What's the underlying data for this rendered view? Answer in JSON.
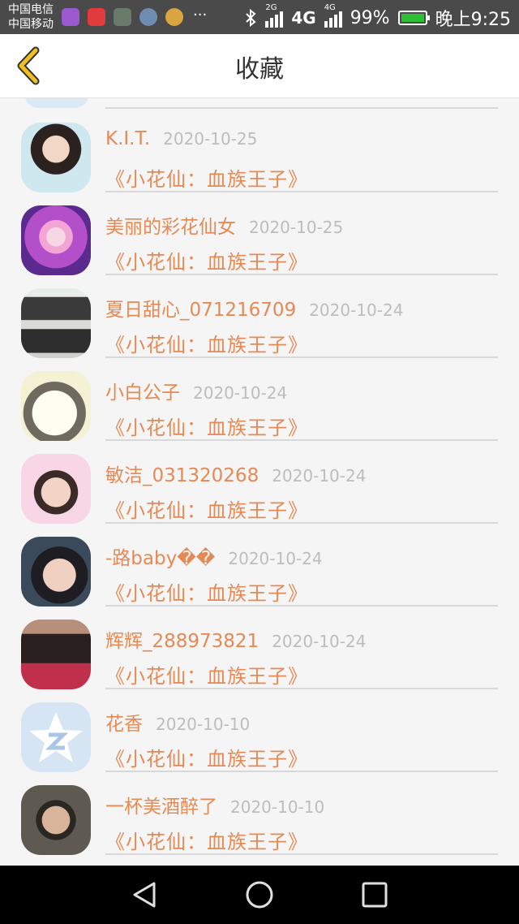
{
  "status_bar": {
    "carrier1": "中国电信",
    "carrier2": "中国移动",
    "more": "···",
    "net1": "2G",
    "net2": "4G",
    "net3": "4G",
    "battery": "99%",
    "battery_level": 0.99,
    "time": "晚上9:25"
  },
  "header": {
    "title": "收藏",
    "back_icon": "chevron-left-icon"
  },
  "items": [
    {
      "name": "K.I.T.",
      "date": "2020-10-25",
      "book": "《小花仙：血族王子》"
    },
    {
      "name": "美丽的彩花仙女",
      "date": "2020-10-25",
      "book": "《小花仙：血族王子》"
    },
    {
      "name": "夏日甜心_071216709",
      "date": "2020-10-24",
      "book": "《小花仙：血族王子》"
    },
    {
      "name": "小白公子",
      "date": "2020-10-24",
      "book": "《小花仙：血族王子》"
    },
    {
      "name": "敏洁_031320268",
      "date": "2020-10-24",
      "book": "《小花仙：血族王子》"
    },
    {
      "name": "-路baby��",
      "date": "2020-10-24",
      "book": "《小花仙：血族王子》"
    },
    {
      "name": "辉辉_288973821",
      "date": "2020-10-24",
      "book": "《小花仙：血族王子》"
    },
    {
      "name": "花香",
      "date": "2020-10-10",
      "book": "《小花仙：血族王子》"
    },
    {
      "name": "一杯美酒醉了",
      "date": "2020-10-10",
      "book": "《小花仙：血族王子》"
    }
  ],
  "colors": {
    "accent": "#e58a55",
    "date": "#bdbdbd",
    "header_bg": "#ffffff",
    "back_arrow": "#f0c020"
  },
  "nav": {
    "back_icon": "triangle-back-icon",
    "home_icon": "circle-home-icon",
    "recent_icon": "square-recent-icon"
  }
}
